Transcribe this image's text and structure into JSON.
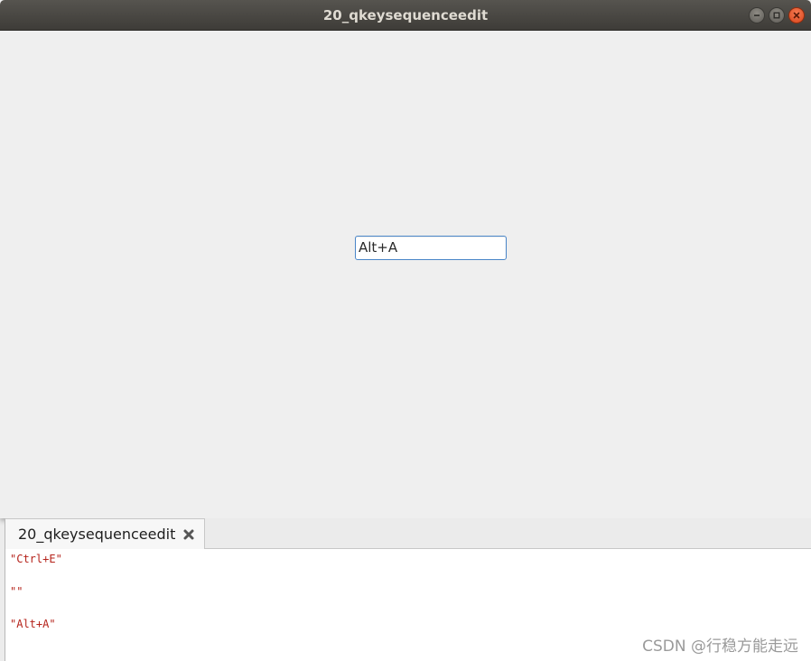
{
  "window": {
    "title": "20_qkeysequenceedit"
  },
  "key_sequence_edit": {
    "value": "Alt+A"
  },
  "output_pane": {
    "tab": {
      "label": "20_qkeysequenceedit"
    },
    "lines": [
      "\"Ctrl+E\"",
      "\"\"",
      "\"Alt+A\""
    ]
  },
  "watermark": {
    "text": "CSDN @行稳方能走远"
  },
  "colors": {
    "titlebar": "#3e3c38",
    "close_button": "#e5541f",
    "input_border": "#4a86c8",
    "output_text": "#b5231b"
  },
  "icons": {
    "minimize": "minimize-icon",
    "maximize": "maximize-icon",
    "close": "close-icon",
    "tab_close": "tab-close-icon"
  }
}
